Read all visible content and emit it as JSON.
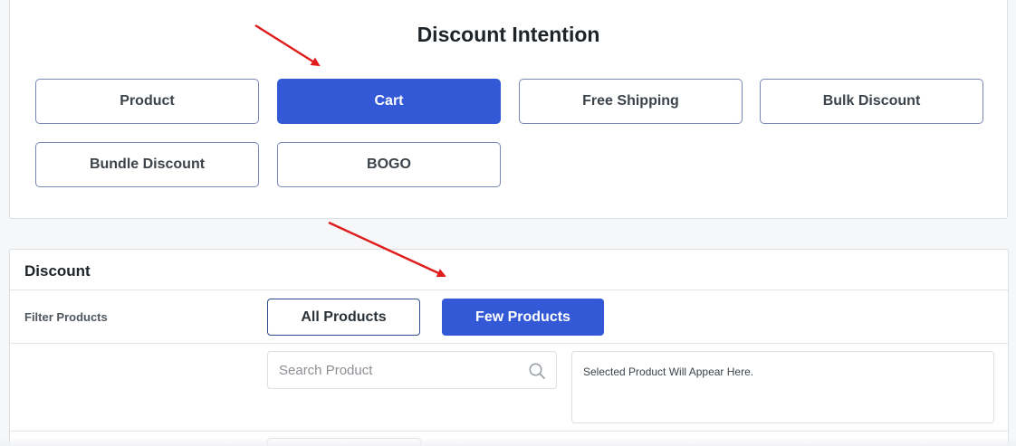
{
  "intention": {
    "title": "Discount Intention",
    "options": [
      {
        "label": "Product",
        "active": false
      },
      {
        "label": "Cart",
        "active": true
      },
      {
        "label": "Free Shipping",
        "active": false
      },
      {
        "label": "Bulk Discount",
        "active": false
      },
      {
        "label": "Bundle Discount",
        "active": false
      },
      {
        "label": "BOGO",
        "active": false
      }
    ]
  },
  "discount": {
    "title": "Discount",
    "filter_label": "Filter Products",
    "filter_options": [
      {
        "label": "All Products",
        "active": false
      },
      {
        "label": "Few Products",
        "active": true
      }
    ],
    "search_placeholder": "Search Product",
    "selected_placeholder": "Selected Product Will Appear Here."
  },
  "colors": {
    "accent": "#3359d6",
    "arrow": "#e01b1b",
    "border": "#7a86b8"
  },
  "icons": {
    "search": "search-icon"
  }
}
